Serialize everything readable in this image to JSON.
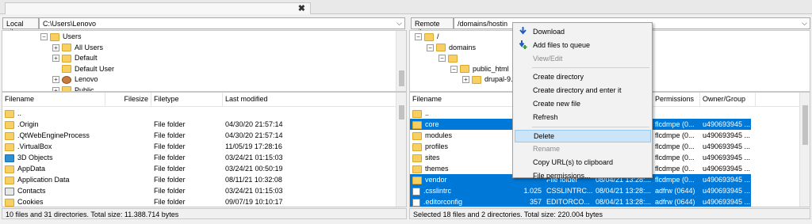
{
  "tab": {
    "close": "✖"
  },
  "local": {
    "label": "Local site:",
    "path": "C:\\Users\\Lenovo",
    "tree": [
      {
        "label": "Users",
        "expander": "−",
        "depth": 0
      },
      {
        "label": "All Users",
        "expander": "+",
        "depth": 1
      },
      {
        "label": "Default",
        "expander": "+",
        "depth": 1
      },
      {
        "label": "Default User",
        "expander": "",
        "depth": 1
      },
      {
        "label": "Lenovo",
        "expander": "+",
        "depth": 1,
        "icon": "user"
      },
      {
        "label": "Public",
        "expander": "+",
        "depth": 1
      }
    ],
    "columns": [
      "Filename",
      "Filesize",
      "Filetype",
      "Last modified"
    ],
    "files": [
      {
        "name": "..",
        "size": "",
        "type": "",
        "modified": "",
        "icon": "folder"
      },
      {
        "name": ".Origin",
        "size": "",
        "type": "File folder",
        "modified": "04/30/20 21:57:14",
        "icon": "folder"
      },
      {
        "name": ".QtWebEngineProcess",
        "size": "",
        "type": "File folder",
        "modified": "04/30/20 21:57:14",
        "icon": "folder"
      },
      {
        "name": ".VirtualBox",
        "size": "",
        "type": "File folder",
        "modified": "11/05/19 17:28:16",
        "icon": "folder"
      },
      {
        "name": "3D Objects",
        "size": "",
        "type": "File folder",
        "modified": "03/24/21 01:15:03",
        "icon": "objects3d"
      },
      {
        "name": "AppData",
        "size": "",
        "type": "File folder",
        "modified": "03/24/21 00:50:19",
        "icon": "folder"
      },
      {
        "name": "Application Data",
        "size": "",
        "type": "File folder",
        "modified": "08/11/21 10:32:08",
        "icon": "folder"
      },
      {
        "name": "Contacts",
        "size": "",
        "type": "File folder",
        "modified": "03/24/21 01:15:03",
        "icon": "contacts"
      },
      {
        "name": "Cookies",
        "size": "",
        "type": "File folder",
        "modified": "09/07/19 10:10:17",
        "icon": "folder"
      }
    ],
    "status": "10 files and 31 directories. Total size: 11.388.714 bytes"
  },
  "remote": {
    "label": "Remote site:",
    "path": "/domains/hostin",
    "tree": [
      {
        "label": "/",
        "expander": "−",
        "depth": 0
      },
      {
        "label": "domains",
        "expander": "−",
        "depth": 1
      },
      {
        "label": "",
        "expander": "−",
        "depth": 2
      },
      {
        "label": "public_html",
        "expander": "−",
        "depth": 3
      },
      {
        "label": "drupal-9.2",
        "expander": "+",
        "depth": 4
      }
    ],
    "columns": [
      "Filename",
      "Permissions",
      "Owner/Group"
    ],
    "files": [
      {
        "name": "..",
        "size": "",
        "type": "",
        "modified": "",
        "perm": "",
        "owner": "",
        "selected": false,
        "icon": "folder"
      },
      {
        "name": "core",
        "size": "",
        "type": "",
        "modified": "",
        "perm": "flcdmpe (0...",
        "owner": "u490693945 ...",
        "selected": true,
        "icon": "folder"
      },
      {
        "name": "modules",
        "size": "",
        "type": "",
        "modified": "",
        "perm": "flcdmpe (0...",
        "owner": "u490693945 ...",
        "selected": false,
        "icon": "folder"
      },
      {
        "name": "profiles",
        "size": "",
        "type": "",
        "modified": "",
        "perm": "flcdmpe (0...",
        "owner": "u490693945 ...",
        "selected": false,
        "icon": "folder"
      },
      {
        "name": "sites",
        "size": "",
        "type": "",
        "modified": "",
        "perm": "flcdmpe (0...",
        "owner": "u490693945 ...",
        "selected": false,
        "icon": "folder"
      },
      {
        "name": "themes",
        "size": "",
        "type": "",
        "modified": "",
        "perm": "flcdmpe (0...",
        "owner": "u490693945 ...",
        "selected": false,
        "icon": "folder"
      },
      {
        "name": "vendor",
        "size": "",
        "type": "File folder",
        "modified": "08/04/21 13:28:...",
        "perm": "flcdmpe (0...",
        "owner": "u490693945 ...",
        "selected": true,
        "icon": "folder"
      },
      {
        "name": ".csslintrc",
        "size": "1.025",
        "type": "CSSLINTRC...",
        "modified": "08/04/21 13:28:...",
        "perm": "adfrw (0644)",
        "owner": "u490693945 ...",
        "selected": true,
        "icon": "file"
      },
      {
        "name": ".editorconfig",
        "size": "357",
        "type": "EDITORCO...",
        "modified": "08/04/21 13:28:...",
        "perm": "adfrw (0644)",
        "owner": "u490693945 ...",
        "selected": true,
        "icon": "file"
      }
    ],
    "status": "Selected 18 files and 2 directories. Total size: 220.004 bytes"
  },
  "context_menu": {
    "items": [
      {
        "label": "Download",
        "icon": "download",
        "disabled": false,
        "highlight": false
      },
      {
        "label": "Add files to queue",
        "icon": "queue",
        "disabled": false,
        "highlight": false
      },
      {
        "label": "View/Edit",
        "icon": "",
        "disabled": true,
        "highlight": false
      },
      {
        "sep": true
      },
      {
        "label": "Create directory",
        "icon": "",
        "disabled": false,
        "highlight": false
      },
      {
        "label": "Create directory and enter it",
        "icon": "",
        "disabled": false,
        "highlight": false
      },
      {
        "label": "Create new file",
        "icon": "",
        "disabled": false,
        "highlight": false
      },
      {
        "label": "Refresh",
        "icon": "",
        "disabled": false,
        "highlight": false
      },
      {
        "sep": true
      },
      {
        "label": "Delete",
        "icon": "",
        "disabled": false,
        "highlight": true
      },
      {
        "label": "Rename",
        "icon": "",
        "disabled": true,
        "highlight": false
      },
      {
        "label": "Copy URL(s) to clipboard",
        "icon": "",
        "disabled": false,
        "highlight": false
      },
      {
        "label": "File permissions...",
        "icon": "",
        "disabled": false,
        "highlight": false
      }
    ]
  },
  "colors": {
    "selection": "#0078d7",
    "folder": "#f7cf62",
    "menu_highlight": "#cce4f7"
  }
}
